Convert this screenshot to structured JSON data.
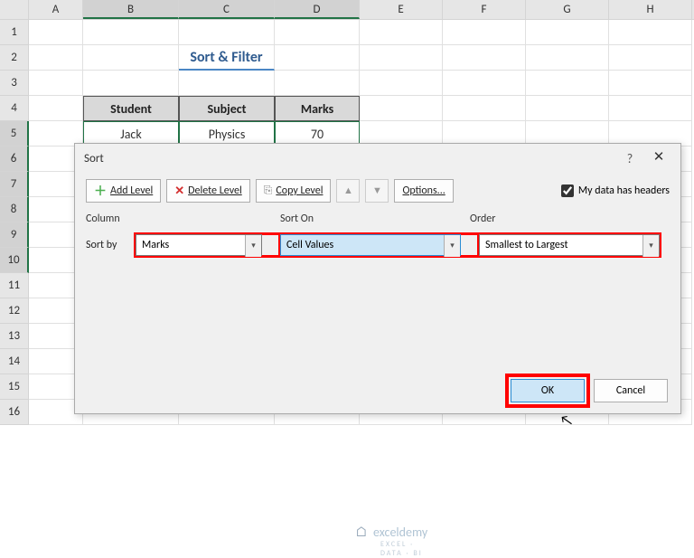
{
  "columns": [
    "A",
    "B",
    "C",
    "D",
    "E",
    "F",
    "G",
    "H"
  ],
  "rows": [
    "1",
    "2",
    "3",
    "4",
    "5",
    "6",
    "7",
    "8",
    "9",
    "10",
    "11",
    "12",
    "13",
    "14",
    "15",
    "16"
  ],
  "sheet": {
    "title": "Sort & Filter",
    "headers": {
      "student": "Student",
      "subject": "Subject",
      "marks": "Marks"
    },
    "data_row": {
      "student": "Jack",
      "subject": "Physics",
      "marks": "70"
    }
  },
  "dialog": {
    "title": "Sort",
    "help": "?",
    "close": "✕",
    "toolbar": {
      "add": "Add Level",
      "delete": "Delete Level",
      "copy": "Copy Level",
      "options": "Options...",
      "headers_label": "My data has headers",
      "headers_checked": true
    },
    "columns": {
      "column": "Column",
      "sorton": "Sort On",
      "order": "Order"
    },
    "row": {
      "label": "Sort by",
      "column_value": "Marks",
      "sorton_value": "Cell Values",
      "order_value": "Smallest to Largest"
    },
    "buttons": {
      "ok": "OK",
      "cancel": "Cancel"
    }
  },
  "watermark": {
    "text": "exceldemy",
    "sub": "EXCEL · DATA · BI"
  }
}
